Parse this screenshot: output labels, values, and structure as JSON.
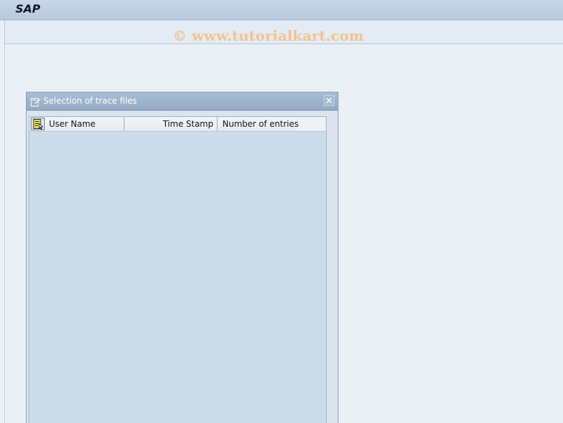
{
  "app": {
    "title": "SAP"
  },
  "watermark": {
    "text": "© www.tutorialkart.com"
  },
  "dialog": {
    "title": "Selection of trace files",
    "columns": [
      "User Name",
      "Time Stamp",
      "Number of entries"
    ],
    "rows": []
  },
  "icons": {
    "dialog": "dialog-window-icon",
    "close": "close-icon",
    "select_all": "select-all-icon"
  },
  "colors": {
    "background": "#eaf0f6",
    "dialog_header": "#a3b9d2",
    "grid_body": "#ccdcea",
    "watermark": "#f2c290"
  }
}
